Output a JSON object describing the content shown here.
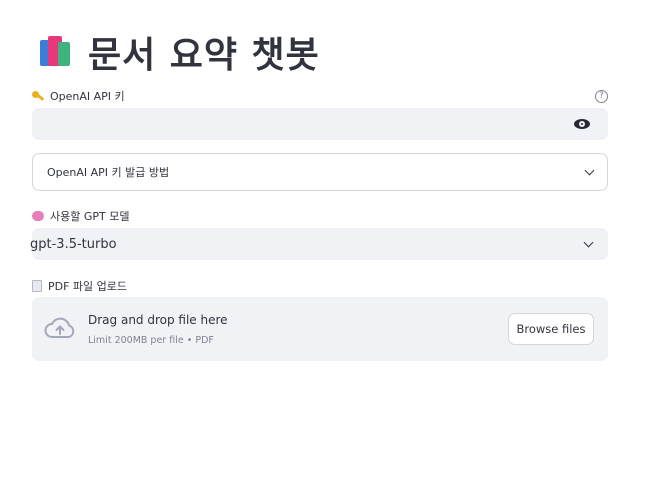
{
  "title": {
    "icon": "books-icon",
    "text": "문서 요약 챗봇"
  },
  "api_key": {
    "label": "OpenAI API 키",
    "value": "",
    "icon": "key-icon",
    "help_icon": "help-circle-icon",
    "toggle_icon": "eye-icon"
  },
  "expander": {
    "label": "OpenAI API 키 발급 방법",
    "icon": "chevron-down-icon"
  },
  "model": {
    "label": "사용할 GPT 모델",
    "icon": "brain-icon",
    "selected": "gpt-3.5-turbo"
  },
  "upload": {
    "label": "PDF 파일 업로드",
    "icon": "document-icon",
    "drag_text": "Drag and drop file here",
    "limit_text": "Limit 200MB per file • PDF",
    "browse_label": "Browse files",
    "cloud_icon": "cloud-upload-icon"
  },
  "colors": {
    "input_bg": "#f0f2f6",
    "text": "#31333f",
    "muted": "#808495",
    "border": "#d6d6d9"
  }
}
